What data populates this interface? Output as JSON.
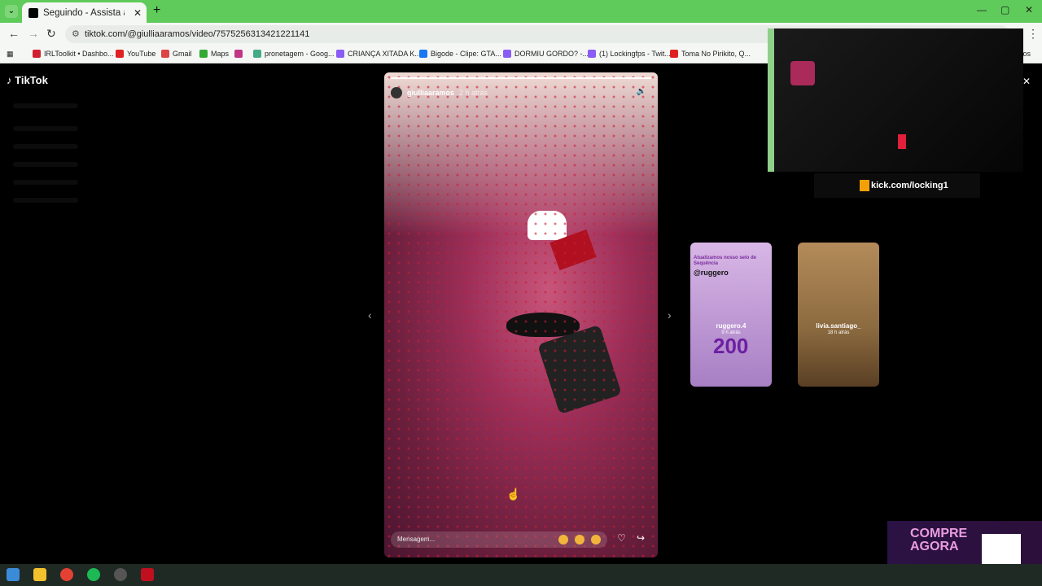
{
  "browser": {
    "tab_title": "Seguindo - Assista aos vídeos",
    "tab_close": "✕",
    "new_tab": "+",
    "url": "tiktok.com/@giulliaaramos/video/7575256313421221141",
    "window_min": "—",
    "window_max": "▢",
    "window_close": "✕",
    "bookmarks": [
      {
        "label": "IRLToolkit • Dashbo...",
        "color": "#d02030"
      },
      {
        "label": "YouTube",
        "color": "#e02020"
      },
      {
        "label": "Gmail",
        "color": "#d44"
      },
      {
        "label": "Maps",
        "color": "#3a3"
      },
      {
        "label": "",
        "color": "#c13584"
      },
      {
        "label": "pronetagem - Goog...",
        "color": "#4a8"
      },
      {
        "label": "CRIANÇA XITADA K...",
        "color": "#8a5cf6"
      },
      {
        "label": "Bigode - Clipe: GTA...",
        "color": "#1877f2"
      },
      {
        "label": "DORMIU GORDO? -...",
        "color": "#8a5cf6"
      },
      {
        "label": "(1) Lockingfps - Twit...",
        "color": "#8a5cf6"
      },
      {
        "label": "Toma No Pirikito, Q...",
        "color": "#e02020"
      }
    ],
    "bookmarks_more": "itos"
  },
  "tiktok": {
    "logo": "TikTok",
    "story": {
      "username": "giulliaaramos",
      "time_ago": "2 h atrás",
      "progress_pct": 100,
      "message_placeholder": "Mensagem..."
    },
    "cards": [
      {
        "top_line1": "Atualizamos nosso selo de",
        "top_line2": "Sequência",
        "handle": "@ruggero",
        "name": "ruggero.4",
        "time_ago": "9 h atrás",
        "big": "200"
      },
      {
        "name": "livia.santiago_",
        "time_ago": "18 h atrás"
      }
    ]
  },
  "overlay": {
    "kick_url": "kick.com/locking1",
    "ad_text_line1": "COMPRE",
    "ad_text_line2": "AGORA"
  }
}
